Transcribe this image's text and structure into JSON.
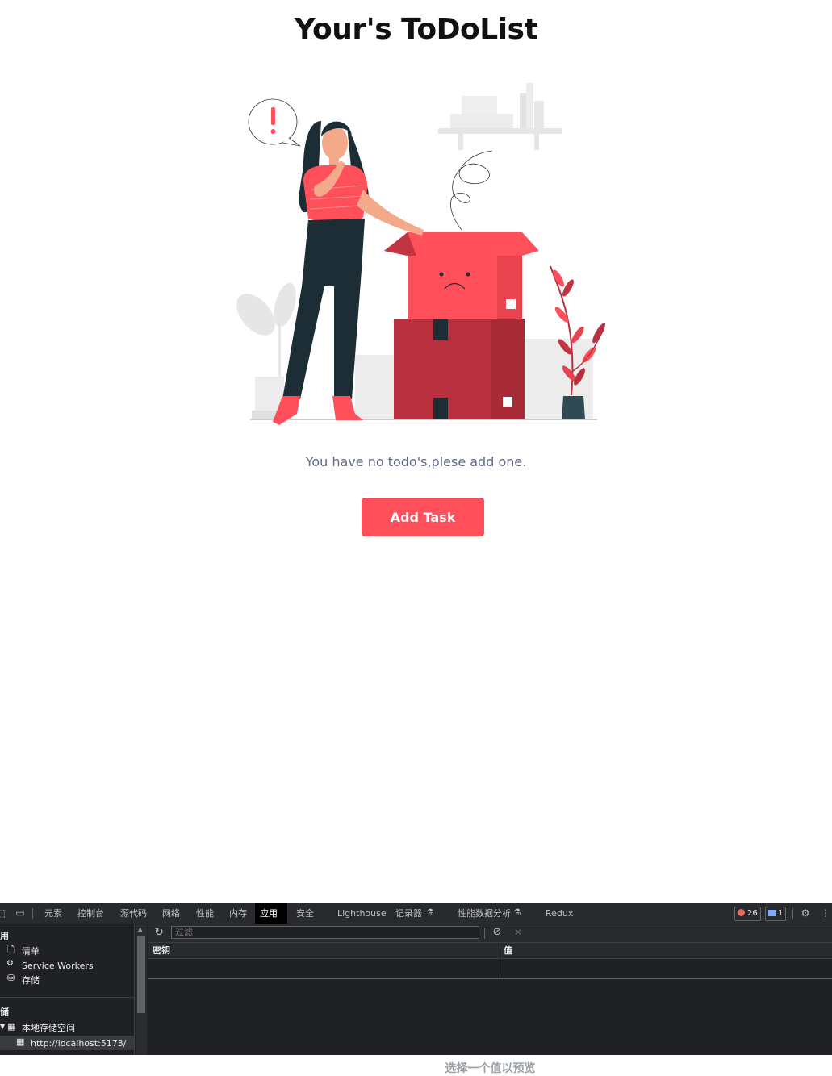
{
  "app": {
    "title": "Your's ToDoList",
    "empty_message": "You have no todo's,plese add one.",
    "add_button": "Add Task",
    "colors": {
      "accent": "#ff4f5a",
      "box_dark": "#b8303d",
      "pants": "#1d2d35",
      "muted_text": "#5f6a8a"
    }
  },
  "devtools": {
    "tabs": [
      "元素",
      "控制台",
      "源代码",
      "网络",
      "性能",
      "内存",
      "应用",
      "安全",
      "Lighthouse",
      "记录器",
      "性能数据分析",
      "Redux"
    ],
    "active_tab": "应用",
    "errors_count": "26",
    "messages_count": "1",
    "sidebar": {
      "app_section": "用",
      "items": [
        "清单",
        "Service Workers",
        "存储"
      ],
      "storage_section": "储",
      "local_storage": "本地存储空间",
      "origin": "http://localhost:5173/"
    },
    "filter_placeholder": "过滤",
    "table_headers": {
      "key": "密钥",
      "value": "值"
    },
    "preview_text": "选择一个值以预览"
  }
}
